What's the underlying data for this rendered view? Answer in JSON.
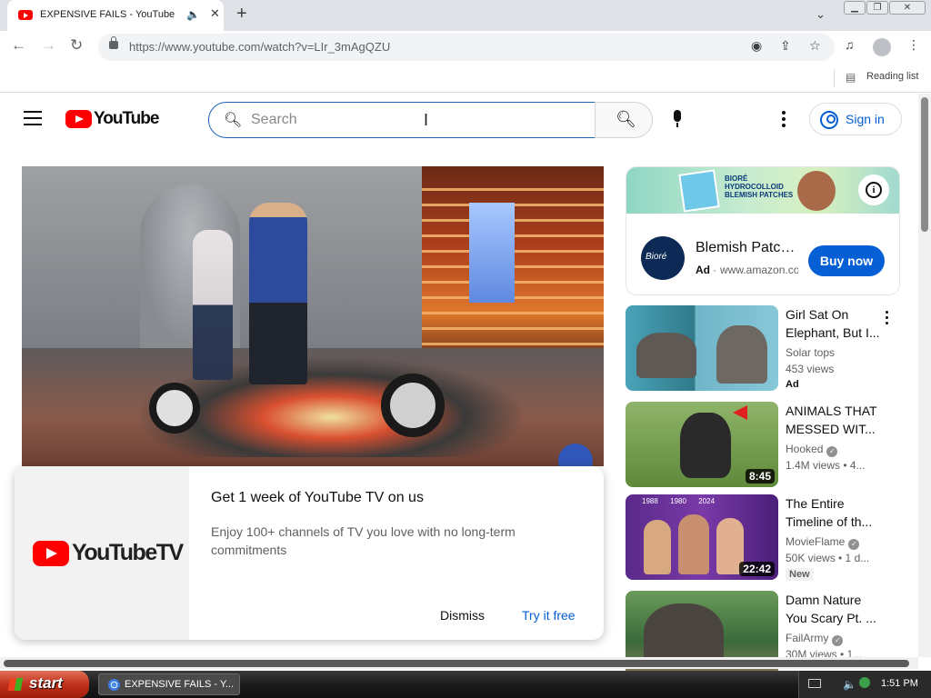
{
  "browser": {
    "tab_title": "EXPENSIVE FAILS - YouTube",
    "url": "https://www.youtube.com/watch?v=LIr_3mAgQZU",
    "reading_list_label": "Reading list"
  },
  "header": {
    "logo_text": "YouTube",
    "search_placeholder": "Search",
    "signin_label": "Sign in"
  },
  "promo": {
    "logo_text": "YouTubeTV",
    "title": "Get 1 week of YouTube TV on us",
    "description": "Enjoy 100+ channels of TV you love with no long-term commitments",
    "dismiss_label": "Dismiss",
    "try_label": "Try it free"
  },
  "ad": {
    "banner_text": "BIORÉ HYDROCOLLOID BLEMISH PATCHES",
    "avatar_text": "Bioré",
    "title": "Blemish Patches",
    "badge": "Ad",
    "url": "www.amazon.com",
    "cta": "Buy now"
  },
  "recommendations": [
    {
      "title_line1": "Girl Sat On",
      "title_line2": "Elephant, But I...",
      "channel": "Solar tops",
      "verified": false,
      "meta": "453 views",
      "badge": "Ad",
      "duration": ""
    },
    {
      "title_line1": "ANIMALS THAT",
      "title_line2": "MESSED WIT...",
      "channel": "Hooked",
      "verified": true,
      "meta": "1.4M views  • 4...",
      "badge": "",
      "duration": "8:45"
    },
    {
      "title_line1": "The Entire",
      "title_line2": "Timeline of th...",
      "channel": "MovieFlame",
      "verified": true,
      "meta": "50K views  • 1 d...",
      "badge": "New",
      "duration": "22:42",
      "timeline": "1988      1980      2024"
    },
    {
      "title_line1": "Damn Nature",
      "title_line2": "You Scary Pt. ...",
      "channel": "FailArmy",
      "verified": true,
      "meta": "30M views  • 1...",
      "badge": "",
      "duration": ""
    }
  ],
  "taskbar": {
    "start_label": "start",
    "task_label": "EXPENSIVE FAILS - Y...",
    "clock": "1:51 PM"
  },
  "colors": {
    "youtube_red": "#ff0000",
    "link_blue": "#065fd4",
    "search_border": "#1c62b9"
  },
  "icons": [
    "tab-favicon",
    "audio-icon",
    "close-icon",
    "plus-icon",
    "back-icon",
    "forward-icon",
    "reload-icon",
    "lock-icon",
    "eye-off-icon",
    "share-icon",
    "star-icon",
    "media-icon",
    "profile-icon",
    "menu-icon",
    "search-icon",
    "mic-icon",
    "more-icon",
    "user-icon",
    "info-icon",
    "verified-icon",
    "windows-flag-icon",
    "chrome-icon"
  ]
}
